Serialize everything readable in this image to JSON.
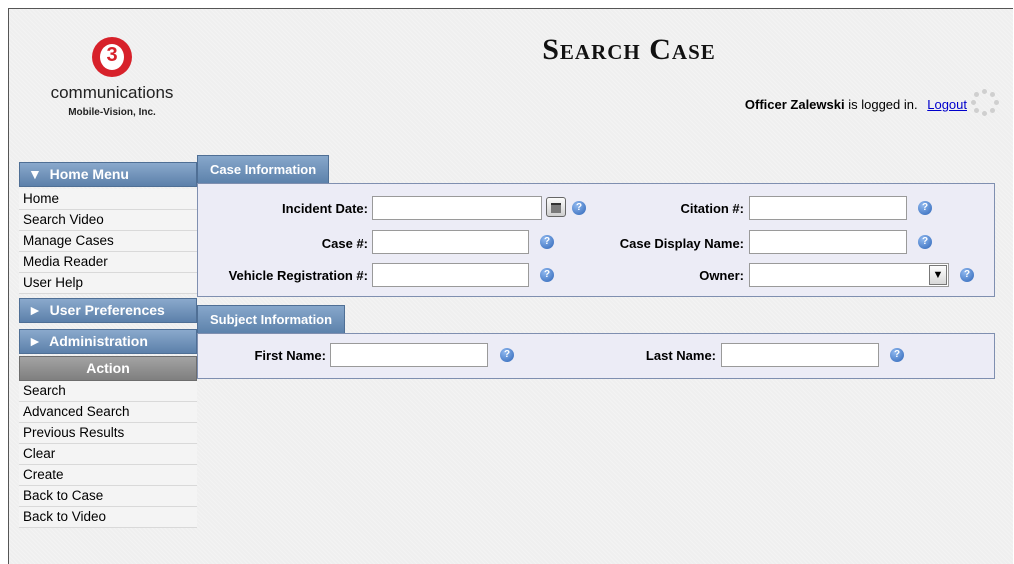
{
  "logo": {
    "mark_text": "3",
    "company": "communications",
    "subtitle": "Mobile-Vision, Inc."
  },
  "header": {
    "title": "Search Case",
    "user_name": "Officer Zalewski",
    "login_suffix": " is logged in.",
    "logout_label": "Logout"
  },
  "sidebar": {
    "home_menu": {
      "label": "Home Menu",
      "items": [
        "Home",
        "Search Video",
        "Manage Cases",
        "Media Reader",
        "User Help"
      ]
    },
    "user_prefs_label": "User Preferences",
    "admin_label": "Administration",
    "action": {
      "label": "Action",
      "items": [
        "Search",
        "Advanced Search",
        "Previous Results",
        "Clear",
        "Create",
        "Back to Case",
        "Back to Video"
      ]
    },
    "icons": {
      "expanded": "triangle-down-icon",
      "collapsed": "triangle-right-icon"
    }
  },
  "case_info": {
    "tab_label": "Case Information",
    "incident_date_label": "Incident Date:",
    "incident_date_value": "",
    "citation_label": "Citation #:",
    "citation_value": "",
    "case_num_label": "Case #:",
    "case_num_value": "",
    "case_display_label": "Case Display Name:",
    "case_display_value": "",
    "vehicle_label": "Vehicle Registration #:",
    "vehicle_value": "",
    "owner_label": "Owner:",
    "owner_value": ""
  },
  "subject_info": {
    "tab_label": "Subject Information",
    "first_name_label": "First Name:",
    "first_name_value": "",
    "last_name_label": "Last Name:",
    "last_name_value": ""
  },
  "icons": {
    "help": "help-icon",
    "calendar": "calendar-icon",
    "spinner": "loading-spinner-icon"
  },
  "colors": {
    "menu_header": "#6f92bb",
    "action_header": "#8f8f8f",
    "panel_bg": "#ececf6",
    "logo_red": "#d7212a",
    "link": "#0000cc"
  }
}
